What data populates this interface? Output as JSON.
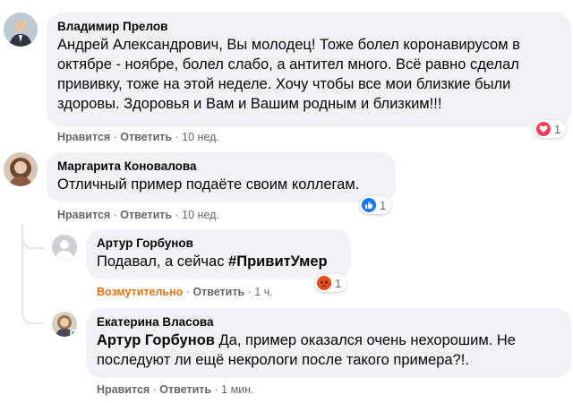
{
  "comments": [
    {
      "author": "Владимир Прелов",
      "text_lines": [
        "Андрей Александрович, Вы молодец! Тоже болел коронавирусом в",
        "октябре - ноябре, болел слабо, а антител много. Всё равно сделал",
        "прививку, тоже на этой неделе. Хочу чтобы все мои близкие были",
        "здоровы. Здоровья и Вам и Вашим родным и близким!!!"
      ],
      "actions": {
        "like": "Нравится",
        "reply": "Ответить",
        "time": "10 нед."
      },
      "reaction": {
        "icon": "love-reaction-icon",
        "count": "1"
      }
    },
    {
      "author": "Маргарита Коновалова",
      "text": "Отличный пример подаёте своим коллегам.",
      "actions": {
        "like": "Нравится",
        "reply": "Ответить",
        "time": "10 нед."
      },
      "reaction": {
        "icon": "like-reaction-icon",
        "count": "1"
      }
    },
    {
      "author": "Артур Горбунов",
      "text_plain": "Подавал, а сейчас ",
      "hashtag": "#ПривитУмер",
      "actions": {
        "like": "Возмутительно",
        "reply": "Ответить",
        "time": "1 ч."
      },
      "reaction": {
        "icon": "angry-reaction-icon",
        "count": "1"
      }
    },
    {
      "author": "Екатерина Власова",
      "mention": "Артур Горбунов",
      "text_line1_rest": " Да, пример оказался очень нехорошим. Не",
      "text_line2": "последуют ли ещё некрологи после такого примера?!.",
      "actions": {
        "like": "Нравится",
        "reply": "Ответить",
        "time": "1 мин."
      }
    }
  ],
  "separator": " · ",
  "colors": {
    "bubble": "#f0f2f5",
    "meta": "#65676b",
    "angry_action": "#e9710f",
    "love": "#f33e58",
    "like": "#1877f2"
  }
}
